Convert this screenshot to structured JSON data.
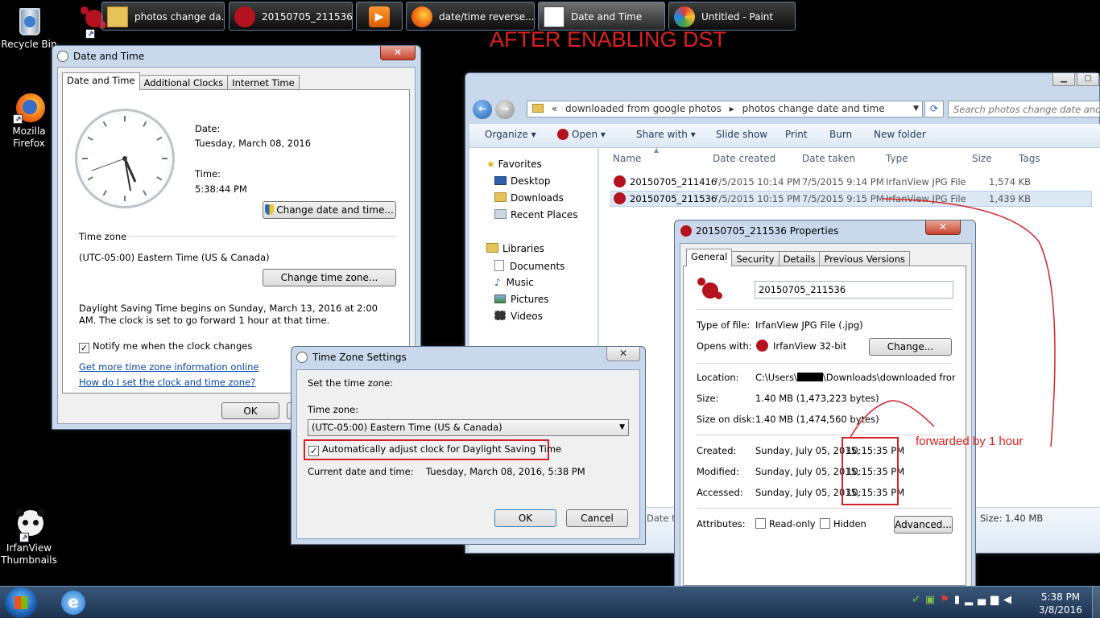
{
  "annotation": {
    "title": "AFTER ENABLING DST",
    "note": "forwarded by 1 hour"
  },
  "desktop": {
    "icons": [
      {
        "label": "Recycle Bin"
      },
      {
        "label": "Mozilla Firefox"
      },
      {
        "label": "IrfanView Thumbnails"
      }
    ]
  },
  "date_time_window": {
    "title": "Date and Time",
    "close": "✕",
    "tabs": [
      "Date and Time",
      "Additional Clocks",
      "Internet Time"
    ],
    "date_label": "Date:",
    "date_value": "Tuesday, March 08, 2016",
    "time_label": "Time:",
    "time_value": "5:38:44 PM",
    "change_datetime_btn": "Change date and time...",
    "timezone_heading": "Time zone",
    "timezone_value": "(UTC-05:00) Eastern Time (US & Canada)",
    "change_timezone_btn": "Change time zone...",
    "dst_text": "Daylight Saving Time begins on Sunday, March 13, 2016 at 2:00 AM. The clock is set to go forward 1 hour at that time.",
    "notify_label": "Notify me when the clock changes",
    "notify_checked": "✓",
    "link1": "Get more time zone information online",
    "link2": "How do I set the clock and time zone?",
    "ok": "OK"
  },
  "timezone_dialog": {
    "title": "Time Zone Settings",
    "close": "✕",
    "set_label": "Set the time zone:",
    "tz_label": "Time zone:",
    "tz_value": "(UTC-05:00) Eastern Time (US & Canada)",
    "dst_checkbox": "Automatically adjust clock for Daylight Saving Time",
    "dst_checked": "✓",
    "current_label": "Current date and time:",
    "current_value": "Tuesday, March 08, 2016, 5:38 PM",
    "ok": "OK",
    "cancel": "Cancel"
  },
  "explorer": {
    "address": [
      "«",
      "downloaded from google photos",
      "▸",
      "photos change date and time"
    ],
    "search_placeholder": "Search photos change date and time",
    "toolbar": [
      "Organize ▾",
      "Open ▾",
      "Share with ▾",
      "Slide show",
      "Print",
      "Burn",
      "New folder"
    ],
    "nav": {
      "favorites": "Favorites",
      "fav_items": [
        "Desktop",
        "Downloads",
        "Recent Places"
      ],
      "libraries": "Libraries",
      "lib_items": [
        "Documents",
        "Music",
        "Pictures",
        "Videos"
      ]
    },
    "columns": [
      "Name",
      "Date created",
      "Date taken",
      "Type",
      "Size",
      "Tags"
    ],
    "rows": [
      {
        "name": "20150705_211416",
        "created": "7/5/2015 10:14 PM",
        "taken": "7/5/2015 9:14 PM",
        "type": "IrfanView JPG File",
        "size": "1,574 KB"
      },
      {
        "name": "20150705_211536",
        "created": "7/5/2015 10:15 PM",
        "taken": "7/5/2015 9:15 PM",
        "type": "IrfanView JPG File",
        "size": "1,439 KB"
      }
    ],
    "status_partial": "Date t",
    "status_size": "Size: 1.40 MB"
  },
  "properties": {
    "title": "20150705_211536 Properties",
    "close": "✕",
    "tabs": [
      "General",
      "Security",
      "Details",
      "Previous Versions"
    ],
    "filename": "20150705_211536",
    "type_label": "Type of file:",
    "type_value": "IrfanView JPG File (.jpg)",
    "opens_label": "Opens with:",
    "opens_value": "IrfanView 32-bit",
    "change_btn": "Change...",
    "location_label": "Location:",
    "location_prefix": "C:\\Users\\",
    "location_suffix": "\\Downloads\\downloaded from goog",
    "size_label": "Size:",
    "size_value": "1.40 MB (1,473,223 bytes)",
    "sizedisk_label": "Size on disk:",
    "sizedisk_value": "1.40 MB (1,474,560 bytes)",
    "created_label": "Created:",
    "created_date": "Sunday, July 05, 2015,",
    "created_time": "10:15:35 PM",
    "modified_label": "Modified:",
    "modified_date": "Sunday, July 05, 2015,",
    "modified_time": "10:15:35 PM",
    "accessed_label": "Accessed:",
    "accessed_date": "Sunday, July 05, 2015,",
    "accessed_time": "10:15:35 PM",
    "attributes_label": "Attributes:",
    "readonly": "Read-only",
    "hidden": "Hidden",
    "advanced_btn": "Advanced..."
  },
  "taskbar": {
    "buttons": [
      "photos change da...",
      "20150705_211536 ...",
      "",
      "date/time reverse...",
      "Date and Time",
      "Untitled - Paint"
    ],
    "time": "5:38 PM",
    "date": "3/8/2016"
  }
}
